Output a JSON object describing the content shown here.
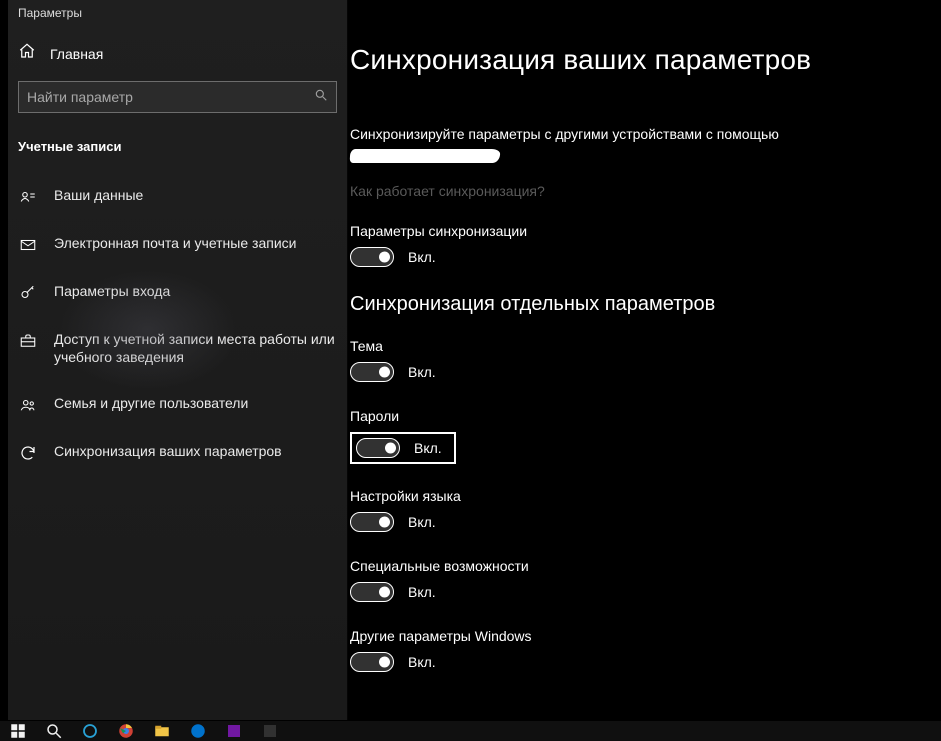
{
  "window_title": "Параметры",
  "home_label": "Главная",
  "search_placeholder": "Найти параметр",
  "section_header": "Учетные записи",
  "nav": [
    {
      "label": "Ваши данные"
    },
    {
      "label": "Электронная почта и учетные записи"
    },
    {
      "label": "Параметры входа"
    },
    {
      "label": "Доступ к учетной записи места работы или учебного заведения"
    },
    {
      "label": "Семья и другие пользователи"
    },
    {
      "label": "Синхронизация ваших параметров"
    }
  ],
  "main": {
    "heading": "Синхронизация ваших параметров",
    "sync_desc_part1": "Синхронизируйте параметры с другими устройствами с помощью ",
    "how_link": "Как работает синхронизация?",
    "master_toggle": {
      "label": "Параметры синхронизации",
      "state": "Вкл."
    },
    "group_heading": "Синхронизация отдельных параметров",
    "items": [
      {
        "label": "Тема",
        "state": "Вкл.",
        "highlight": false
      },
      {
        "label": "Пароли",
        "state": "Вкл.",
        "highlight": true
      },
      {
        "label": "Настройки языка",
        "state": "Вкл.",
        "highlight": false
      },
      {
        "label": "Специальные возможности",
        "state": "Вкл.",
        "highlight": false
      },
      {
        "label": "Другие параметры Windows",
        "state": "Вкл.",
        "highlight": false
      }
    ]
  }
}
